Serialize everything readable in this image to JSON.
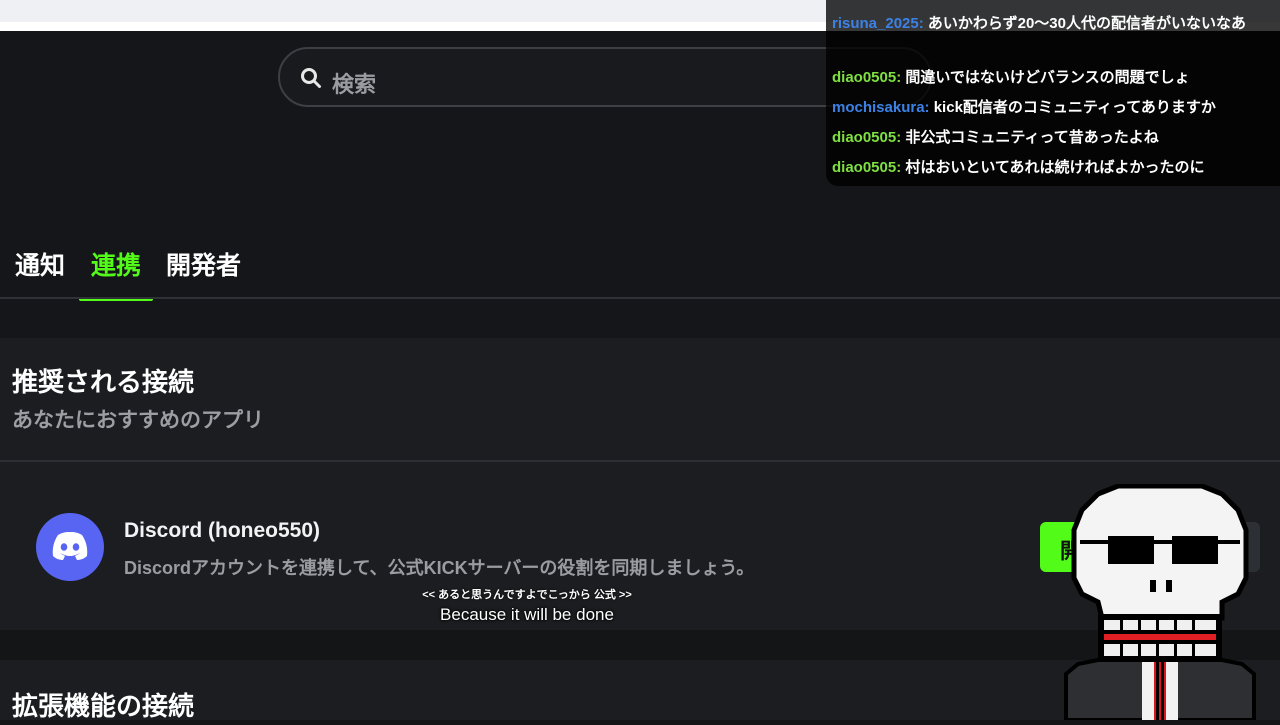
{
  "search": {
    "placeholder": "検索",
    "icon": "search-icon"
  },
  "tabs": [
    {
      "label": "通知",
      "active": false
    },
    {
      "label": "連携",
      "active": true
    },
    {
      "label": "開発者",
      "active": false
    }
  ],
  "recommended": {
    "title": "推奨される接続",
    "subtitle": "あなたにおすすめのアプリ",
    "items": [
      {
        "icon": "discord-icon",
        "name": "Discord (honeo550)",
        "description": "Discordアカウントを連携して、公式KICKサーバーの役割を同期しましょう。",
        "button_label": "開"
      }
    ]
  },
  "extensions": {
    "title": "拡張機能の接続"
  },
  "chat": {
    "messages": [
      {
        "user": "risuna_2025:",
        "text": "あいかわらず20～30人代の配信者がいないなあ",
        "user_color": "#3c82e6"
      },
      {
        "user": "diao0505:",
        "text": "間違いではないけどバランスの問題でしょ",
        "user_color": "#7fe042"
      },
      {
        "user": "mochisakura:",
        "text": "kick配信者のコミュニティってありますか",
        "user_color": "#3c82e6"
      },
      {
        "user": "diao0505:",
        "text": "非公式コミュニティって昔あったよね",
        "user_color": "#7fe042"
      },
      {
        "user": "diao0505:",
        "text": "村はおいといてあれは続ければよかったのに",
        "user_color": "#7fe042"
      }
    ]
  },
  "subtitles": {
    "original": "<< あると思うんですよでこっから 公式 >>",
    "translation": "Because it will be done"
  },
  "colors": {
    "accent": "#53fc18",
    "background": "#151619",
    "panel": "#1b1d20",
    "discord": "#5865f2"
  }
}
